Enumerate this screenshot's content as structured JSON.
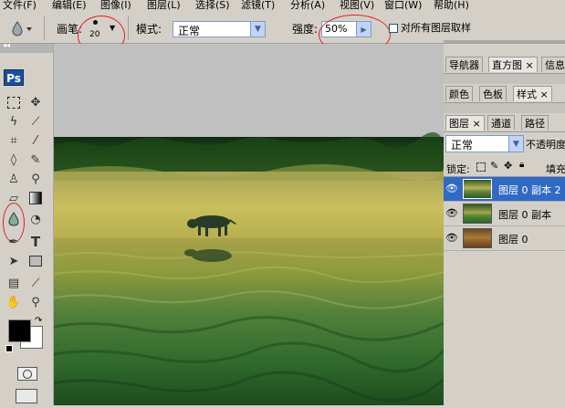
{
  "menu": {
    "items": [
      "文件(F)",
      "编辑(E)",
      "图像(I)",
      "图层(L)",
      "选择(S)",
      "滤镜(T)",
      "分析(A)",
      "视图(V)",
      "窗口(W)",
      "帮助(H)"
    ]
  },
  "options": {
    "brush_label": "画笔:",
    "brush_size": "20",
    "mode_label": "模式:",
    "mode_value": "正常",
    "strength_label": "强度:",
    "strength_value": "50%",
    "sample_all_label": "对所有图层取样"
  },
  "toolbox": {
    "logo": "Ps"
  },
  "panels": {
    "group1_tabs": [
      "导航器",
      "直方图",
      "信息"
    ],
    "group2_tabs": [
      "颜色",
      "色板",
      "样式"
    ],
    "layers_tabs": [
      "图层",
      "通道",
      "路径"
    ],
    "blend_mode": "正常",
    "opacity_label": "不透明度",
    "lock_label": "锁定:",
    "fill_label": "填充",
    "layers": [
      {
        "name": "图层 0 副本 2",
        "selected": true
      },
      {
        "name": "图层 0 副本",
        "selected": false
      },
      {
        "name": "图层 0",
        "selected": false
      }
    ]
  },
  "colors": {
    "selection": "#316ac5",
    "annotation_red": "#dd2222"
  }
}
